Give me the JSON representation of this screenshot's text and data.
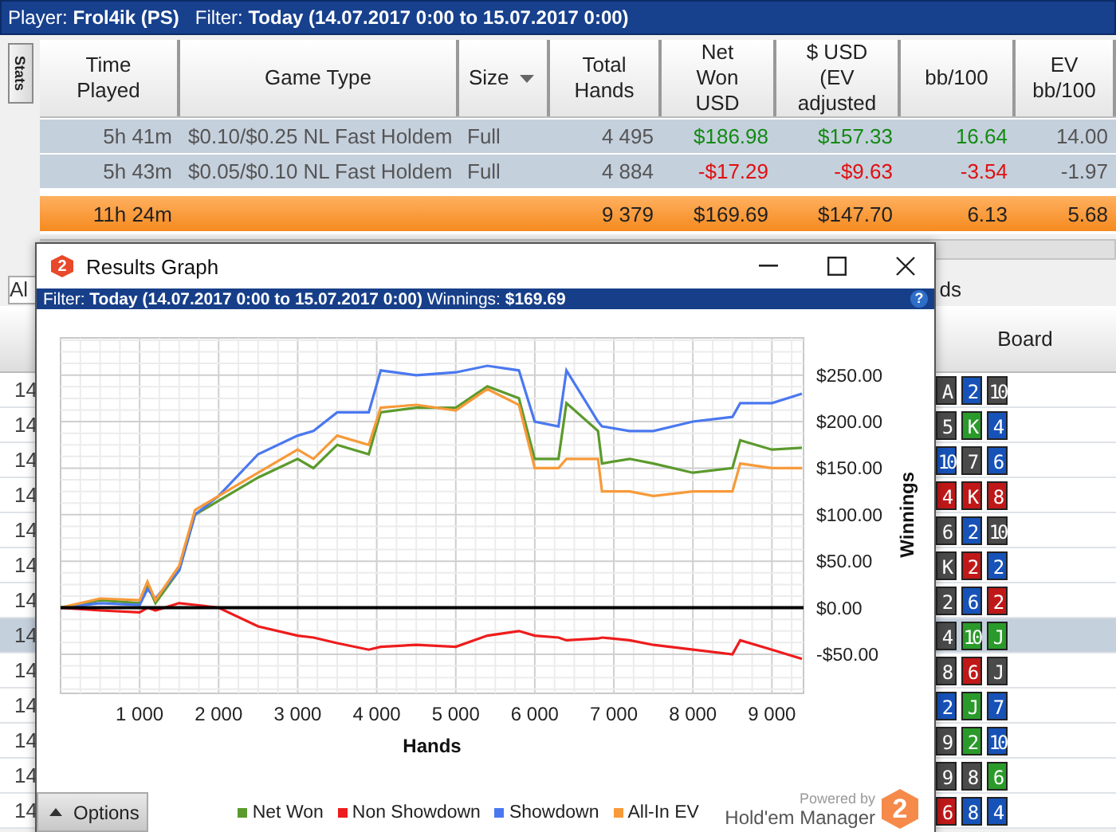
{
  "header": {
    "player_label": "Player:",
    "player": "Frol4ik (PS)",
    "filter_label": "Filter:",
    "filter": "Today (14.07.2017 0:00 to 15.07.2017 0:00)"
  },
  "side_tab": "Stats",
  "stats_table": {
    "columns": [
      {
        "label": "Time\nPlayed"
      },
      {
        "label": "Game Type"
      },
      {
        "label": "Size",
        "dropdown": true
      },
      {
        "label": "Total\nHands"
      },
      {
        "label": "Net\nWon\nUSD"
      },
      {
        "label": "$ USD\n(EV\nadjusted"
      },
      {
        "label": "bb/100"
      },
      {
        "label": "EV\nbb/100"
      }
    ],
    "rows": [
      {
        "cells": [
          {
            "text": "5h 41m"
          },
          {
            "text": "$0.10/$0.25 NL Fast Holdem"
          },
          {
            "text": "Full"
          },
          {
            "text": "4 495"
          },
          {
            "text": "$186.98",
            "color": "#138a13"
          },
          {
            "text": "$157.33",
            "color": "#138a13"
          },
          {
            "text": "16.64",
            "color": "#138a13"
          },
          {
            "text": "14.00"
          }
        ]
      },
      {
        "cells": [
          {
            "text": "5h 43m"
          },
          {
            "text": "$0.05/$0.10 NL Fast Holdem"
          },
          {
            "text": "Full"
          },
          {
            "text": "4 884"
          },
          {
            "text": "-$17.29",
            "color": "#e01010"
          },
          {
            "text": "-$9.63",
            "color": "#e01010"
          },
          {
            "text": "-3.54",
            "color": "#e01010"
          },
          {
            "text": "-1.97"
          }
        ]
      }
    ],
    "totals": {
      "time_played": "11h 24m",
      "total_hands": "9 379",
      "net_won": "$169.69",
      "ev_adjusted": "$147.70",
      "bb_100": "6.13",
      "ev_bb_100": "5.68"
    }
  },
  "dropdown_text": "Al",
  "partial_text": "ds",
  "hands_table": {
    "board_header": "Board",
    "rows": [
      {
        "cell": "14",
        "selected": false,
        "board": [
          {
            "rank": "A",
            "color": "#4a4a4a"
          },
          {
            "rank": "2",
            "color": "#1652b8"
          },
          {
            "rank": "10",
            "color": "#4a4a4a"
          }
        ]
      },
      {
        "cell": "14",
        "selected": false,
        "board": [
          {
            "rank": "5",
            "color": "#4a4a4a"
          },
          {
            "rank": "K",
            "color": "#2a9a2a"
          },
          {
            "rank": "4",
            "color": "#1652b8"
          }
        ]
      },
      {
        "cell": "14",
        "selected": false,
        "board": [
          {
            "rank": "10",
            "color": "#1652b8"
          },
          {
            "rank": "7",
            "color": "#4a4a4a"
          },
          {
            "rank": "6",
            "color": "#1652b8"
          }
        ]
      },
      {
        "cell": "14",
        "selected": false,
        "board": [
          {
            "rank": "4",
            "color": "#c01818"
          },
          {
            "rank": "K",
            "color": "#c01818"
          },
          {
            "rank": "8",
            "color": "#c01818"
          }
        ]
      },
      {
        "cell": "14",
        "selected": false,
        "board": [
          {
            "rank": "6",
            "color": "#4a4a4a"
          },
          {
            "rank": "2",
            "color": "#1652b8"
          },
          {
            "rank": "10",
            "color": "#4a4a4a"
          }
        ]
      },
      {
        "cell": "14",
        "selected": false,
        "board": [
          {
            "rank": "K",
            "color": "#4a4a4a"
          },
          {
            "rank": "2",
            "color": "#c01818"
          },
          {
            "rank": "2",
            "color": "#1652b8"
          }
        ]
      },
      {
        "cell": "14",
        "selected": false,
        "board": [
          {
            "rank": "2",
            "color": "#4a4a4a"
          },
          {
            "rank": "6",
            "color": "#1652b8"
          },
          {
            "rank": "2",
            "color": "#c01818"
          }
        ]
      },
      {
        "cell": "14",
        "selected": true,
        "board": [
          {
            "rank": "4",
            "color": "#4a4a4a"
          },
          {
            "rank": "10",
            "color": "#2a9a2a"
          },
          {
            "rank": "J",
            "color": "#2a9a2a"
          }
        ]
      },
      {
        "cell": "14",
        "selected": false,
        "board": [
          {
            "rank": "8",
            "color": "#4a4a4a"
          },
          {
            "rank": "6",
            "color": "#c01818"
          },
          {
            "rank": "J",
            "color": "#4a4a4a"
          }
        ]
      },
      {
        "cell": "14",
        "selected": false,
        "board": [
          {
            "rank": "2",
            "color": "#1652b8"
          },
          {
            "rank": "J",
            "color": "#2a9a2a"
          },
          {
            "rank": "7",
            "color": "#1652b8"
          }
        ]
      },
      {
        "cell": "14",
        "selected": false,
        "board": [
          {
            "rank": "9",
            "color": "#4a4a4a"
          },
          {
            "rank": "2",
            "color": "#2a9a2a"
          },
          {
            "rank": "10",
            "color": "#1652b8"
          }
        ]
      },
      {
        "cell": "14",
        "selected": false,
        "board": [
          {
            "rank": "9",
            "color": "#4a4a4a"
          },
          {
            "rank": "8",
            "color": "#4a4a4a"
          },
          {
            "rank": "6",
            "color": "#2a9a2a"
          }
        ]
      },
      {
        "cell": "14",
        "selected": false,
        "board": [
          {
            "rank": "6",
            "color": "#c01818"
          },
          {
            "rank": "8",
            "color": "#1652b8"
          },
          {
            "rank": "4",
            "color": "#1652b8"
          }
        ]
      }
    ]
  },
  "graph": {
    "title": "Results Graph",
    "logo": "2",
    "help": "?",
    "filter_label": "Filter:",
    "filter": "Today (14.07.2017 0:00 to 15.07.2017 0:00)",
    "winnings_label": "Winnings:",
    "winnings": "$169.69",
    "chart_data": {
      "type": "line",
      "grid": true,
      "xlabel": "Hands",
      "ylabel": "Winnings",
      "x": [
        0,
        500,
        1000,
        1100,
        1200,
        1500,
        1700,
        2000,
        2500,
        3000,
        3200,
        3500,
        3900,
        4050,
        4500,
        5000,
        5400,
        5800,
        6000,
        6300,
        6400,
        6800,
        6850,
        7200,
        7500,
        8000,
        8500,
        8600,
        9000,
        9379
      ],
      "series": [
        {
          "name": "Net Won",
          "color": "#5b9a2c",
          "values": [
            0,
            8,
            5,
            25,
            5,
            40,
            100,
            115,
            140,
            160,
            150,
            175,
            165,
            210,
            215,
            215,
            238,
            225,
            160,
            160,
            220,
            190,
            155,
            160,
            155,
            145,
            150,
            180,
            170,
            172
          ]
        },
        {
          "name": "Non Showdown",
          "color": "#ee1c1c",
          "values": [
            0,
            -3,
            -5,
            0,
            -3,
            5,
            3,
            0,
            -20,
            -30,
            -32,
            -38,
            -45,
            -42,
            -40,
            -42,
            -30,
            -25,
            -30,
            -32,
            -35,
            -33,
            -32,
            -35,
            -40,
            -45,
            -50,
            -35,
            -45,
            -55
          ]
        },
        {
          "name": "Showdown",
          "color": "#4a78f0",
          "values": [
            0,
            5,
            3,
            20,
            10,
            40,
            100,
            120,
            165,
            185,
            190,
            210,
            210,
            255,
            250,
            253,
            260,
            255,
            200,
            195,
            255,
            200,
            195,
            190,
            190,
            200,
            205,
            220,
            220,
            230
          ]
        },
        {
          "name": "All-In EV",
          "color": "#f79a3a",
          "values": [
            0,
            10,
            8,
            28,
            8,
            45,
            105,
            120,
            145,
            170,
            160,
            185,
            175,
            215,
            218,
            212,
            235,
            218,
            150,
            150,
            160,
            160,
            125,
            125,
            120,
            125,
            125,
            155,
            150,
            150
          ]
        }
      ],
      "xlim": [
        0,
        9400
      ],
      "ylim": [
        -92,
        290
      ],
      "xticks": [
        {
          "value": 1000,
          "label": "1 000"
        },
        {
          "value": 2000,
          "label": "2 000"
        },
        {
          "value": 3000,
          "label": "3 000"
        },
        {
          "value": 4000,
          "label": "4 000"
        },
        {
          "value": 5000,
          "label": "5 000"
        },
        {
          "value": 6000,
          "label": "6 000"
        },
        {
          "value": 7000,
          "label": "7 000"
        },
        {
          "value": 8000,
          "label": "8 000"
        },
        {
          "value": 9000,
          "label": "9 000"
        }
      ],
      "yticks": [
        {
          "value": -50,
          "label": "-$50.00"
        },
        {
          "value": 0,
          "label": "$0.00"
        },
        {
          "value": 50,
          "label": "$50.00"
        },
        {
          "value": 100,
          "label": "$100.00"
        },
        {
          "value": 150,
          "label": "$150.00"
        },
        {
          "value": 200,
          "label": "$200.00"
        },
        {
          "value": 250,
          "label": "$250.00"
        }
      ]
    },
    "options_button": "Options",
    "branding": {
      "powered_by": "Powered by",
      "name": "Hold'em Manager",
      "logo": "2"
    }
  }
}
